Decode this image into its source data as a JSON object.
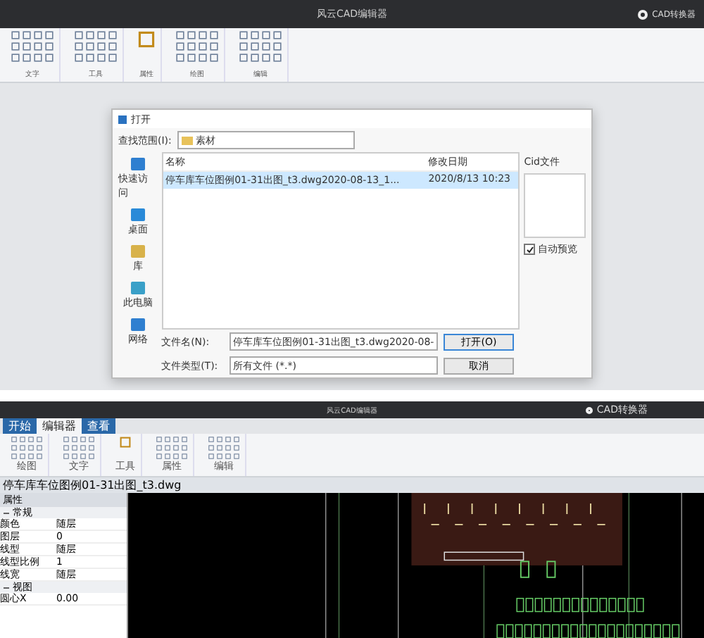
{
  "app_title": "风云CAD编辑器",
  "converter_button": "CAD转换器",
  "ribbon": {
    "groups": [
      "文字",
      "工具",
      "属性",
      "绘图",
      "编辑"
    ]
  },
  "dialog": {
    "title": "打开",
    "look_in_label": "查找范围(I):",
    "folder": "素材",
    "places": [
      {
        "label": "快速访问"
      },
      {
        "label": "桌面"
      },
      {
        "label": "库"
      },
      {
        "label": "此电脑"
      },
      {
        "label": "网络"
      }
    ],
    "columns": [
      "名称",
      "修改日期"
    ],
    "files": [
      {
        "name": "停车库车位图例01-31出图_t3.dwg2020-08-13_1...",
        "date": "2020/8/13 10:23",
        "selected": true
      }
    ],
    "file_name_label": "文件名(N):",
    "file_name": "停车库车位图例01-31出图_t3.dwg2020-08-",
    "file_type_label": "文件类型(T):",
    "file_type": "所有文件 (*.*)",
    "open_button": "打开(O)",
    "cancel_button": "取消",
    "preview_label": "Cid文件",
    "auto_preview": {
      "label": "自动预览",
      "checked": true
    }
  },
  "editor": {
    "title": "风云CAD编辑器",
    "converter_button": "CAD转换器",
    "tabs": [
      {
        "label": "开始",
        "selected": false
      },
      {
        "label": "编辑器",
        "selected": true
      },
      {
        "label": "查看",
        "selected": false
      }
    ],
    "ribbon_groups": [
      "绘图",
      "文字",
      "工具",
      "属性",
      "编辑"
    ],
    "document_tab": "停车库车位图例01-31出图_t3.dwg",
    "properties": {
      "title": "属性",
      "sections": [
        {
          "title": "常规",
          "expanded": true,
          "rows": [
            {
              "name": "颜色",
              "value": "随层"
            },
            {
              "name": "图层",
              "value": "0"
            },
            {
              "name": "线型",
              "value": "随层"
            },
            {
              "name": "线型比例",
              "value": "1"
            },
            {
              "name": "线宽",
              "value": "随层"
            }
          ]
        },
        {
          "title": "视图",
          "expanded": true,
          "rows": [
            {
              "name": "圆心X",
              "value": "0.00"
            }
          ]
        }
      ]
    }
  }
}
